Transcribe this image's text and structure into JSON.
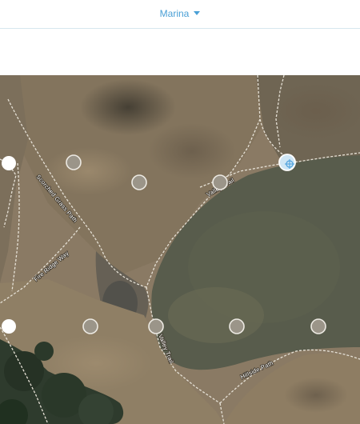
{
  "header": {
    "location_selector": {
      "label": "Marina",
      "icon": "caret-down-icon",
      "accent_color": "#4aa0d6"
    }
  },
  "map": {
    "trail_labels": {
      "scorched_grass_path": "Scorched Grass Path",
      "fire_ridge_way": "Fire Ridge Way",
      "valley_trail_upper": "Valley Trail",
      "valley_trail_lower": "Valley Trail",
      "hillside_path": "Hillside Path"
    },
    "markers": [
      {
        "id": "marker-1",
        "style": "white"
      },
      {
        "id": "marker-2",
        "style": "grey"
      },
      {
        "id": "marker-3",
        "style": "grey"
      },
      {
        "id": "marker-4",
        "style": "grey"
      },
      {
        "id": "marker-5",
        "style": "selected",
        "icon": "crosshair-icon"
      },
      {
        "id": "marker-6",
        "style": "white"
      },
      {
        "id": "marker-7",
        "style": "grey"
      },
      {
        "id": "marker-8",
        "style": "grey"
      },
      {
        "id": "marker-9",
        "style": "grey"
      },
      {
        "id": "marker-10",
        "style": "grey"
      }
    ],
    "colors": {
      "dry_grass": "#8a7a64",
      "green_hill": "#55594a",
      "trees": "#2d3a2c",
      "trail": "#e6e1d6",
      "selected_marker": "#5aa8e0"
    }
  }
}
